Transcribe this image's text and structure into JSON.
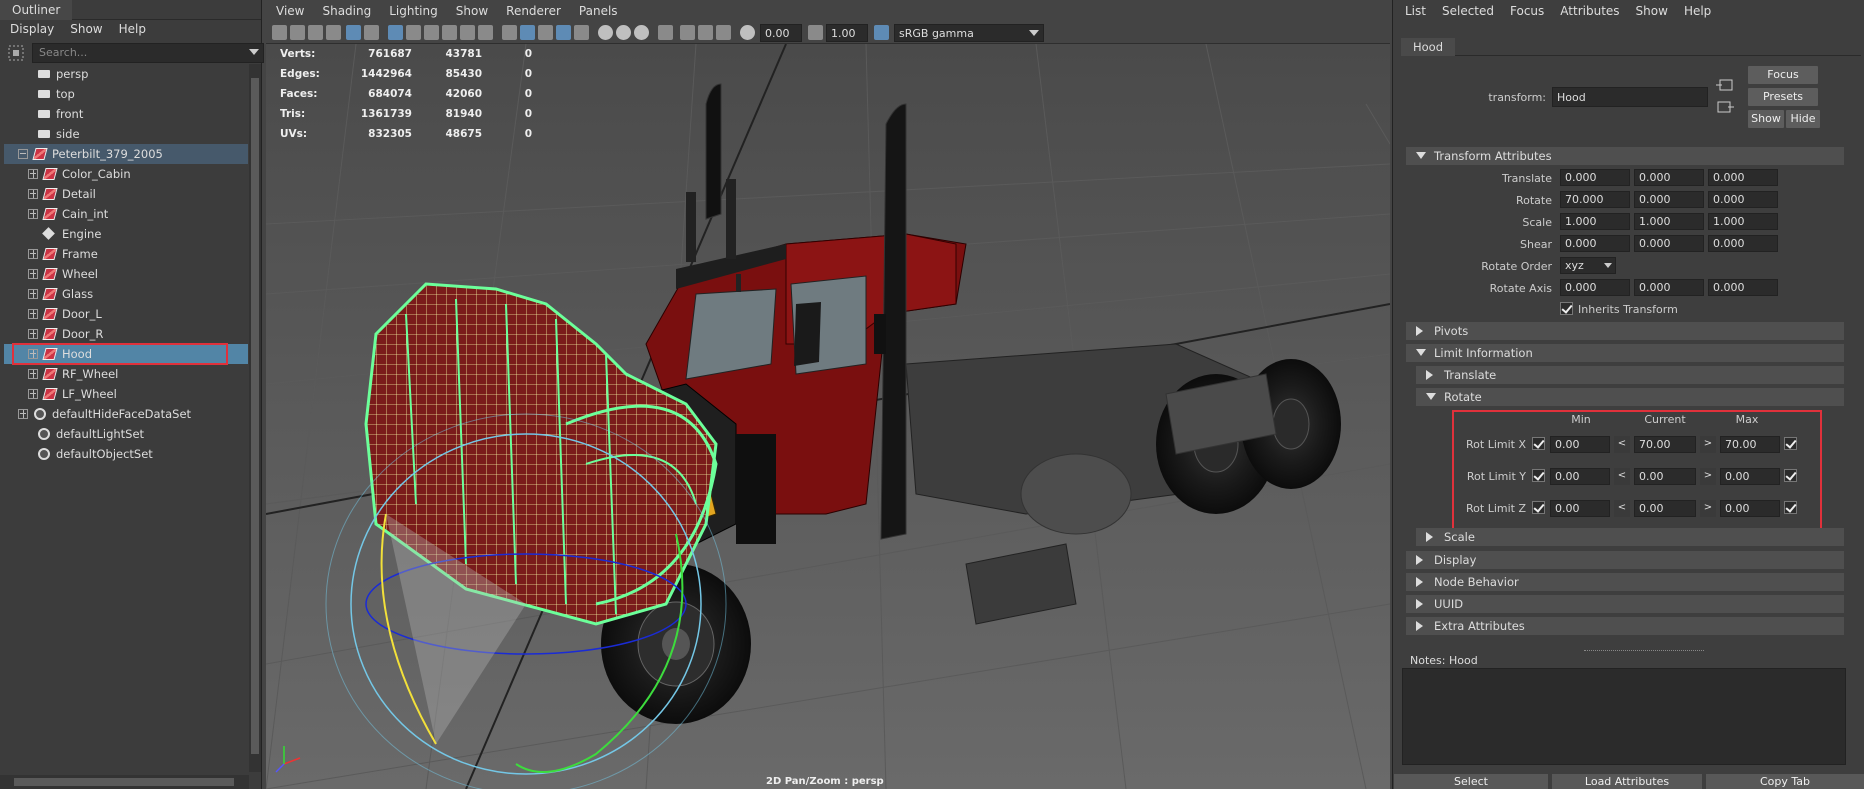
{
  "outliner": {
    "title": "Outliner",
    "menu": [
      "Display",
      "Show",
      "Help"
    ],
    "search_placeholder": "Search...",
    "items": [
      {
        "label": "persp",
        "icon": "camera-icon",
        "indent": 1
      },
      {
        "label": "top",
        "icon": "camera-icon",
        "indent": 1
      },
      {
        "label": "front",
        "icon": "camera-icon",
        "indent": 1
      },
      {
        "label": "side",
        "icon": "camera-icon",
        "indent": 1
      },
      {
        "label": "Peterbilt_379_2005",
        "icon": "mesh-icon",
        "indent": 0
      },
      {
        "label": "Color_Cabin",
        "icon": "mesh-icon",
        "indent": 2
      },
      {
        "label": "Detail",
        "icon": "mesh-icon",
        "indent": 2
      },
      {
        "label": "Cain_int",
        "icon": "mesh-icon",
        "indent": 2
      },
      {
        "label": "Engine",
        "icon": "joint-icon",
        "indent": 2
      },
      {
        "label": "Frame",
        "icon": "mesh-icon",
        "indent": 2
      },
      {
        "label": "Wheel",
        "icon": "mesh-icon",
        "indent": 2
      },
      {
        "label": "Glass",
        "icon": "mesh-icon",
        "indent": 2
      },
      {
        "label": "Door_L",
        "icon": "mesh-icon",
        "indent": 2
      },
      {
        "label": "Door_R",
        "icon": "mesh-icon",
        "indent": 2
      },
      {
        "label": "Hood",
        "icon": "mesh-icon",
        "indent": 2
      },
      {
        "label": "RF_Wheel",
        "icon": "mesh-icon",
        "indent": 2
      },
      {
        "label": "LF_Wheel",
        "icon": "mesh-icon",
        "indent": 2
      },
      {
        "label": "defaultHideFaceDataSet",
        "icon": "set-icon",
        "indent": 0
      },
      {
        "label": "defaultLightSet",
        "icon": "set-icon",
        "indent": 1
      },
      {
        "label": "defaultObjectSet",
        "icon": "set-icon",
        "indent": 1
      }
    ]
  },
  "viewport": {
    "menu": [
      "View",
      "Shading",
      "Lighting",
      "Show",
      "Renderer",
      "Panels"
    ],
    "exposure": "0.00",
    "gamma": "1.00",
    "color_space": "sRGB gamma",
    "hud": [
      {
        "label": "Verts:",
        "a": "761687",
        "b": "43781",
        "c": "0"
      },
      {
        "label": "Edges:",
        "a": "1442964",
        "b": "85430",
        "c": "0"
      },
      {
        "label": "Faces:",
        "a": "684074",
        "b": "42060",
        "c": "0"
      },
      {
        "label": "Tris:",
        "a": "1361739",
        "b": "81940",
        "c": "0"
      },
      {
        "label": "UVs:",
        "a": "832305",
        "b": "48675",
        "c": "0"
      }
    ],
    "camera_label": "2D Pan/Zoom : persp",
    "colors": {
      "selection_wire": "#6cff9a",
      "body_red": "#8a1010",
      "grid": "#5e5e5e"
    }
  },
  "attr": {
    "menu": [
      "List",
      "Selected",
      "Focus",
      "Attributes",
      "Show",
      "Help"
    ],
    "tab": "Hood",
    "transform_label": "transform:",
    "transform_value": "Hood",
    "buttons": {
      "focus": "Focus",
      "presets": "Presets",
      "show": "Show",
      "hide": "Hide"
    },
    "sections": {
      "transform": "Transform Attributes",
      "pivots": "Pivots",
      "limit": "Limit Information",
      "translate": "Translate",
      "rotate": "Rotate",
      "scale": "Scale",
      "display": "Display",
      "node_behavior": "Node Behavior",
      "uuid": "UUID",
      "extra": "Extra Attributes"
    },
    "transform_rows": [
      {
        "label": "Translate",
        "x": "0.000",
        "y": "0.000",
        "z": "0.000"
      },
      {
        "label": "Rotate",
        "x": "70.000",
        "y": "0.000",
        "z": "0.000"
      },
      {
        "label": "Scale",
        "x": "1.000",
        "y": "1.000",
        "z": "1.000"
      },
      {
        "label": "Shear",
        "x": "0.000",
        "y": "0.000",
        "z": "0.000"
      }
    ],
    "rotate_order_label": "Rotate Order",
    "rotate_order": "xyz",
    "rotate_axis": {
      "label": "Rotate Axis",
      "x": "0.000",
      "y": "0.000",
      "z": "0.000"
    },
    "inherits_transform": "Inherits Transform",
    "limit_headers": {
      "min": "Min",
      "current": "Current",
      "max": "Max"
    },
    "limit_rows": [
      {
        "label": "Rot Limit X",
        "min": "0.00",
        "current": "70.00",
        "max": "70.00"
      },
      {
        "label": "Rot Limit Y",
        "min": "0.00",
        "current": "0.00",
        "max": "0.00"
      },
      {
        "label": "Rot Limit Z",
        "min": "0.00",
        "current": "0.00",
        "max": "0.00"
      }
    ],
    "notes_label": "Notes:  Hood",
    "bottom": {
      "select": "Select",
      "load": "Load Attributes",
      "copy": "Copy Tab"
    }
  }
}
